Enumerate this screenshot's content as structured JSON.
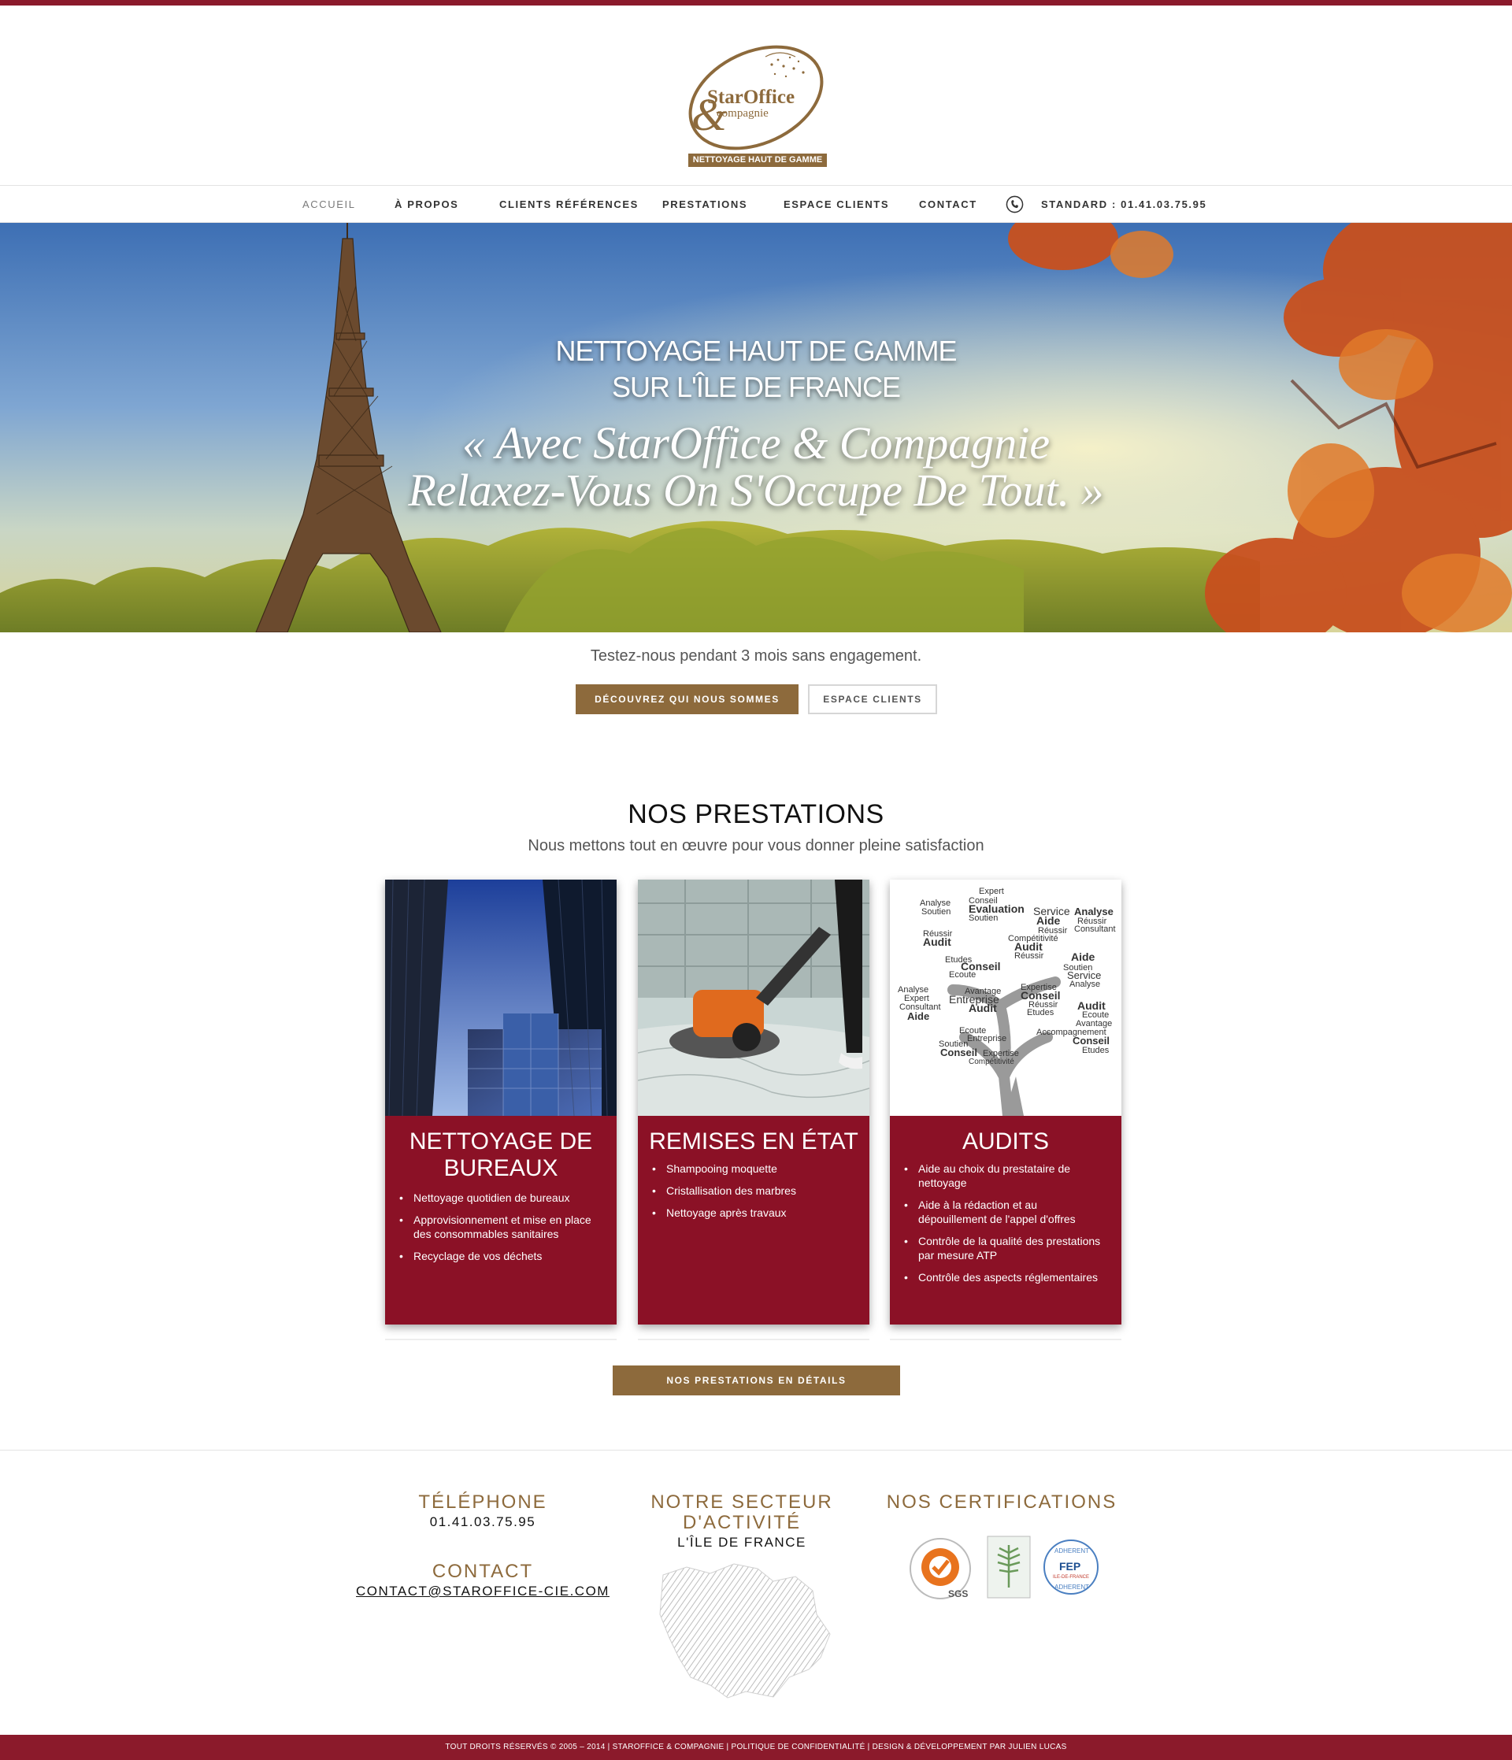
{
  "brand": {
    "logo_name": "StarOffice",
    "logo_sub": "compagnie",
    "tagline": "NETTOYAGE HAUT DE GAMME"
  },
  "nav": {
    "items": [
      {
        "label": "ACCUEIL",
        "active": true
      },
      {
        "label": "À PROPOS"
      },
      {
        "label": "CLIENTS RÉFÉRENCES"
      },
      {
        "label": "PRESTATIONS"
      },
      {
        "label": "ESPACE CLIENTS"
      },
      {
        "label": "CONTACT"
      }
    ],
    "phone": "STANDARD : 01.41.03.75.95"
  },
  "hero": {
    "title_line1": "NETTOYAGE HAUT DE GAMME",
    "title_line2": "SUR L'ÎLE DE FRANCE",
    "quote_line1": "« Avec StarOffice & Compagnie",
    "quote_line2": "Relaxez-Vous On S'Occupe De Tout. »"
  },
  "cta": {
    "tagline": "Testez-nous pendant 3 mois sans engagement.",
    "primary": "DÉCOUVREZ QUI NOUS SOMMES",
    "secondary": "ESPACE CLIENTS"
  },
  "prestations": {
    "title": "NOS PRESTATIONS",
    "subtitle": "Nous mettons tout en œuvre pour vous donner pleine satisfaction",
    "cards": [
      {
        "title_line1": "NETTOYAGE DE",
        "title_line2": "BUREAUX",
        "items": [
          "Nettoyage quotidien de bureaux",
          "Approvisionnement et mise en place des consommables sanitaires",
          "Recyclage de vos déchets"
        ]
      },
      {
        "title_line1": "REMISES EN ÉTAT",
        "items": [
          "Shampooing moquette",
          "Cristallisation des marbres",
          "Nettoyage après travaux"
        ]
      },
      {
        "title_line1": "AUDITS",
        "items": [
          "Aide au choix du prestataire de nettoyage",
          "Aide à la rédaction et au dépouillement de l'appel d'offres",
          "Contrôle de la qualité des prestations par mesure ATP",
          "Contrôle des aspects réglementaires"
        ]
      }
    ],
    "details_button": "NOS PRESTATIONS EN DÉTAILS"
  },
  "audit_words": [
    "Expert",
    "Conseil",
    "Evaluation",
    "Soutien",
    "Analyse",
    "Service",
    "Aide",
    "Réussir",
    "Audit",
    "Compétitivité",
    "Etudes",
    "Entreprise",
    "Avantage",
    "Ecoute",
    "Expertise",
    "Accompagnement",
    "Consultant"
  ],
  "footer": {
    "telephone_label": "TÉLÉPHONE",
    "telephone": "01.41.03.75.95",
    "contact_label": "CONTACT",
    "contact_email": "CONTACT@STAROFFICE-CIE.COM",
    "sector_label_line1": "NOTRE SECTEUR",
    "sector_label_line2": "D'ACTIVITÉ",
    "sector_value": "L'ÎLE DE FRANCE",
    "cert_label": "NOS CERTIFICATIONS",
    "cert1_text": "SGS",
    "cert3_top": "ADHERENT",
    "cert3_mid": "FEP",
    "cert3_sub": "ILE-DE-FRANCE",
    "copyright": "TOUT DROITS RÉSERVÉS © 2005 – 2014 | STAROFFICE & COMPAGNIE | POLITIQUE DE CONFIDENTIALITÉ | DESIGN & DÉVELOPPEMENT PAR JULIEN LUCAS"
  },
  "colors": {
    "bordeaux": "#8b1a2b",
    "gold": "#8d6a3c",
    "card": "#8b1126"
  }
}
